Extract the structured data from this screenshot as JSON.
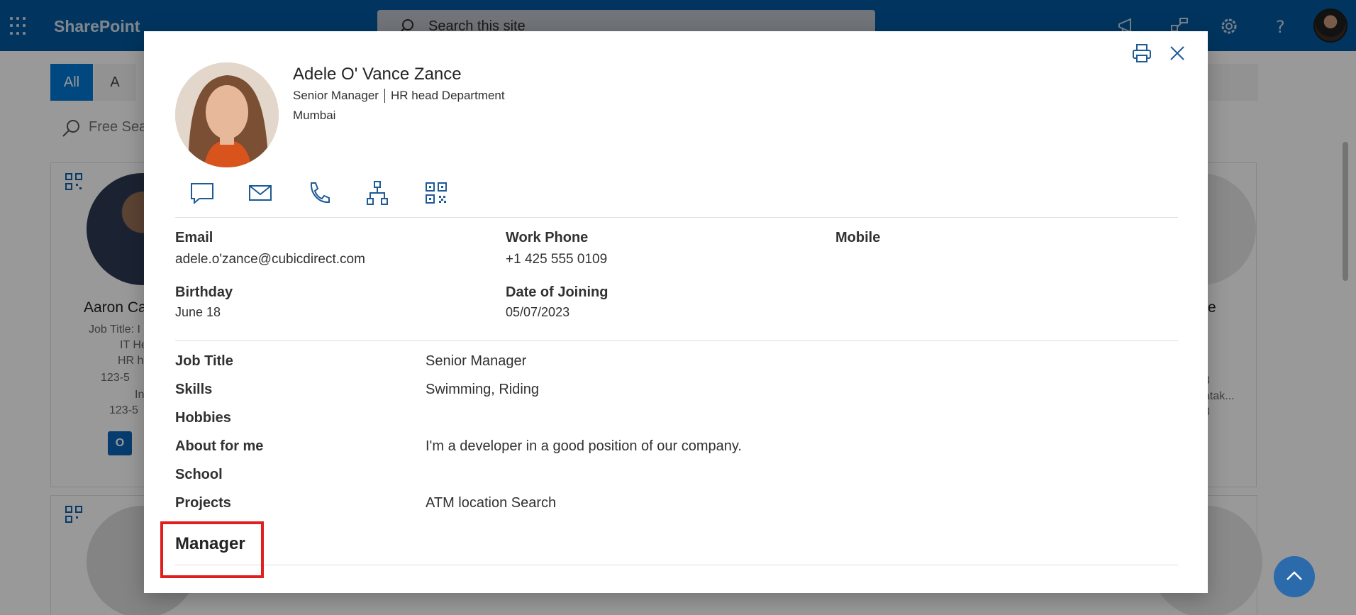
{
  "suite_bar": {
    "app_name": "SharePoint",
    "search_placeholder": "Search this site"
  },
  "background": {
    "filters": [
      "All",
      "A"
    ],
    "free_search_placeholder": "Free Sea",
    "cards": [
      {
        "name": "Aaron Ca",
        "job_title": "Job Title: I",
        "line2": "IT He",
        "line3": "HR h",
        "mobile": "123-5",
        "location": "In",
        "phone": "123-5"
      }
    ],
    "right_fragments": [
      "e",
      "3",
      "atak...",
      "3"
    ]
  },
  "profile": {
    "name": "Adele O' Vance Zance",
    "job_title": "Senior Manager",
    "department": "HR head Department",
    "location": "Mumbai",
    "actions": [
      "chat-icon",
      "mail-icon",
      "phone-icon",
      "org-chart-icon",
      "qr-code-icon"
    ],
    "contact": {
      "email_label": "Email",
      "email": "adele.o'zance@cubicdirect.com",
      "work_phone_label": "Work Phone",
      "work_phone": "+1 425 555 0109",
      "mobile_label": "Mobile",
      "mobile": "",
      "birthday_label": "Birthday",
      "birthday": "June 18",
      "doj_label": "Date of Joining",
      "doj": "05/07/2023"
    },
    "details": [
      {
        "label": "Job Title",
        "value": "Senior Manager"
      },
      {
        "label": "Skills",
        "value": "Swimming, Riding"
      },
      {
        "label": "Hobbies",
        "value": ""
      },
      {
        "label": "About for me",
        "value": "I'm a developer in a good position of our company."
      },
      {
        "label": "School",
        "value": ""
      },
      {
        "label": "Projects",
        "value": "ATM location Search"
      }
    ],
    "manager_heading": "Manager"
  },
  "colors": {
    "suite_bar": "#03599f",
    "accent": "#0078d4",
    "icon_blue": "#1d5a96",
    "highlight": "#e01e1e"
  }
}
